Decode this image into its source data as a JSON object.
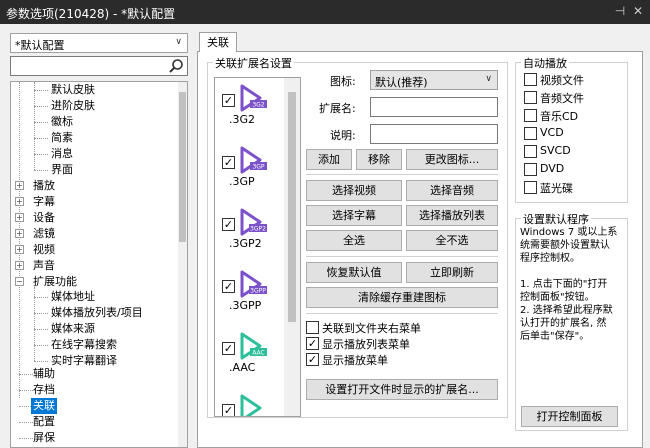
{
  "window": {
    "title": "参数选项(210428) - *默认配置",
    "pin_glyph": "⊣",
    "close_glyph": "✕"
  },
  "profile": {
    "value": "*默认配置"
  },
  "tree": {
    "items": [
      {
        "label": "默认皮肤"
      },
      {
        "label": "进阶皮肤"
      },
      {
        "label": "徽标"
      },
      {
        "label": "简素"
      },
      {
        "label": "消息"
      },
      {
        "label": "界面"
      },
      {
        "label": "播放"
      },
      {
        "label": "字幕"
      },
      {
        "label": "设备"
      },
      {
        "label": "滤镜"
      },
      {
        "label": "视频"
      },
      {
        "label": "声音"
      },
      {
        "label": "扩展功能"
      },
      {
        "label": "媒体地址"
      },
      {
        "label": "媒体播放列表/项目"
      },
      {
        "label": "媒体来源"
      },
      {
        "label": "在线字幕搜索"
      },
      {
        "label": "实时字幕翻译"
      },
      {
        "label": "辅助"
      },
      {
        "label": "存档"
      },
      {
        "label": "关联"
      },
      {
        "label": "配置"
      },
      {
        "label": "屏保"
      }
    ],
    "selected": "关联",
    "expander_collapsed": "+",
    "expander_expanded": "−"
  },
  "tabs": [
    {
      "label": "关联"
    }
  ],
  "assoc": {
    "group_title": "关联扩展名设置",
    "extensions": [
      {
        "name": ".3G2",
        "badge": "3G2",
        "checked": true,
        "color": "#7b52c9"
      },
      {
        "name": ".3GP",
        "badge": "3GP",
        "checked": true,
        "color": "#7b52c9"
      },
      {
        "name": ".3GP2",
        "badge": "3GP2",
        "checked": true,
        "color": "#7b52c9"
      },
      {
        "name": ".3GPP",
        "badge": "3GPP",
        "checked": true,
        "color": "#7b52c9"
      },
      {
        "name": ".AAC",
        "badge": "AAC",
        "checked": true,
        "color": "#2dbf9a"
      },
      {
        "name": "",
        "badge": "",
        "checked": true,
        "color": "#2dbf9a"
      }
    ],
    "icon_label": "图标:",
    "icon_value": "默认(推荐)",
    "ext_label": "扩展名:",
    "desc_label": "说明:",
    "buttons": {
      "add": "添加",
      "remove": "移除",
      "change_icon": "更改图标...",
      "select_video": "选择视频",
      "select_audio": "选择音频",
      "select_subtitle": "选择字幕",
      "select_playlist": "选择播放列表",
      "select_all": "全选",
      "select_none": "全不选",
      "restore_default": "恢复默认值",
      "refresh_now": "立即刷新",
      "clear_cache": "清除缓存重建图标",
      "set_open_ext": "设置打开文件时显示的扩展名..."
    },
    "options": [
      {
        "label": "关联到文件夹右菜单",
        "checked": false
      },
      {
        "label": "显示播放列表菜单",
        "checked": true
      },
      {
        "label": "显示播放菜单",
        "checked": true
      }
    ],
    "check_glyph": "✓"
  },
  "autoplay": {
    "title": "自动播放",
    "items": [
      {
        "label": "视频文件",
        "checked": false
      },
      {
        "label": "音频文件",
        "checked": false
      },
      {
        "label": "音乐CD",
        "checked": false
      },
      {
        "label": "VCD",
        "checked": false
      },
      {
        "label": "SVCD",
        "checked": false
      },
      {
        "label": "DVD",
        "checked": false
      },
      {
        "label": "蓝光碟",
        "checked": false
      }
    ]
  },
  "default_program": {
    "title": "设置默认程序",
    "lines": [
      "Windows 7 或以上系",
      "统需要额外设置默认",
      "程序控制权。",
      "",
      "1. 点击下面的\"打开",
      "控制面板\"按钮。",
      "2. 选择希望此程序默",
      "认打开的扩展名, 然",
      "后单击\"保存\"。"
    ],
    "button": "打开控制面板"
  }
}
